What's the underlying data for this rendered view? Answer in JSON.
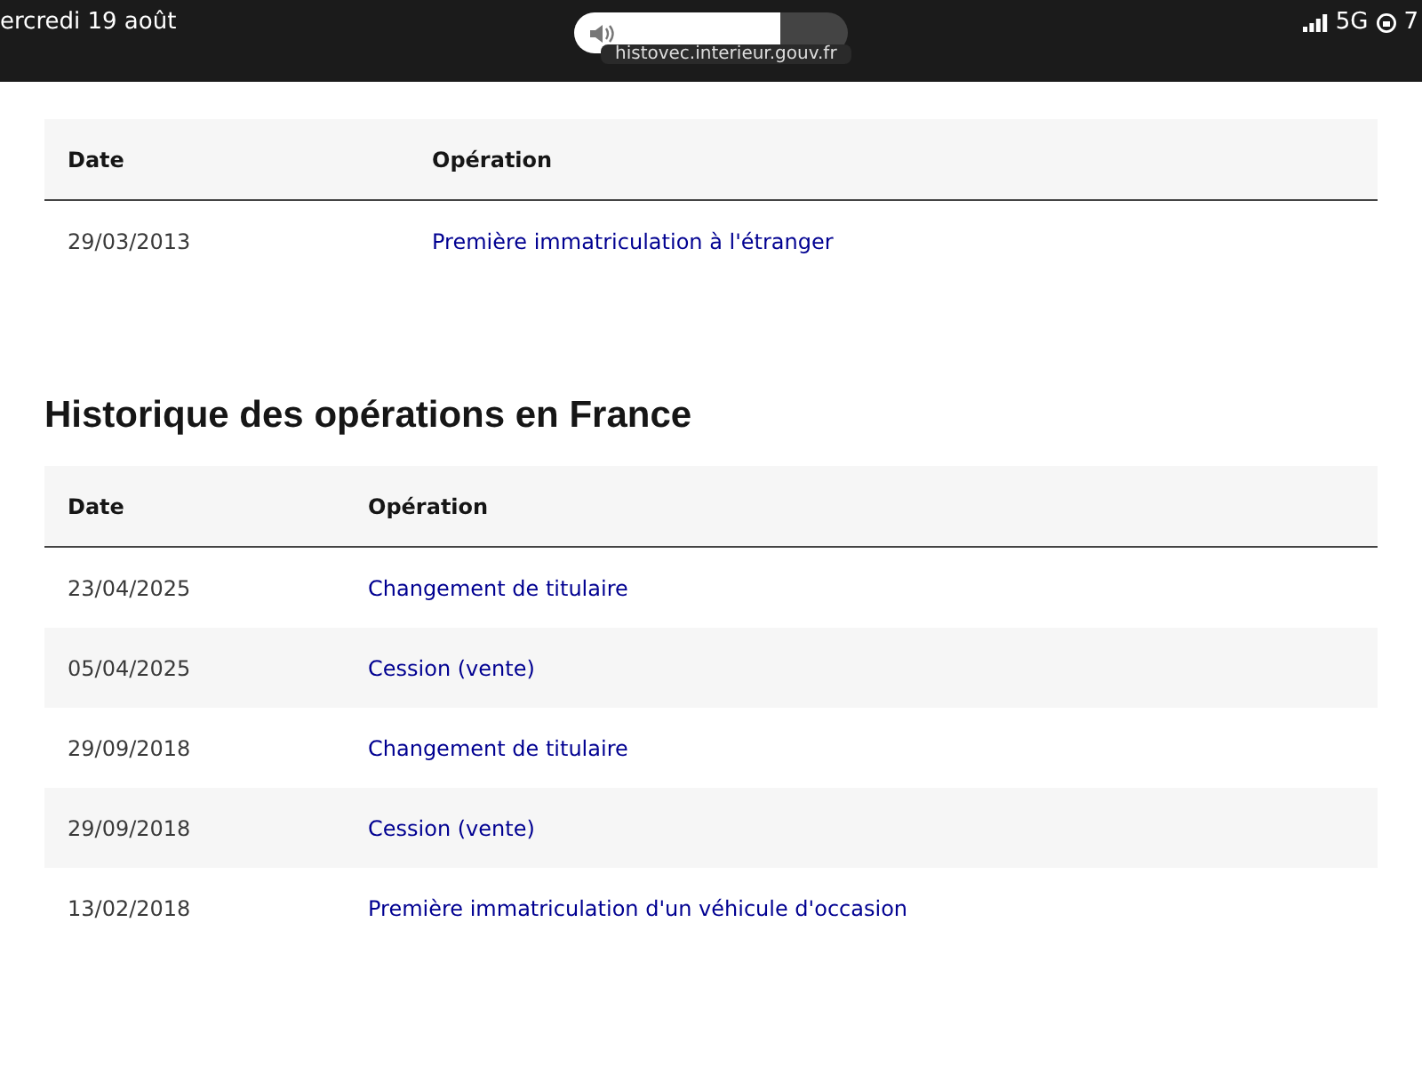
{
  "status_bar": {
    "date": "ercredi 19 août",
    "network": "5G",
    "battery": "7",
    "volume": {
      "level": 0.75
    },
    "url": "histovec.interieur.gouv.fr"
  },
  "sections": [
    {
      "columns": [
        "Date",
        "Opération"
      ],
      "rows": [
        {
          "date": "29/03/2013",
          "operation": "Première immatriculation à l'étranger"
        }
      ]
    },
    {
      "title": "Historique des opérations en France",
      "columns": [
        "Date",
        "Opération"
      ],
      "rows": [
        {
          "date": "23/04/2025",
          "operation": "Changement de titulaire"
        },
        {
          "date": "05/04/2025",
          "operation": "Cession (vente)"
        },
        {
          "date": "29/09/2018",
          "operation": "Changement de titulaire"
        },
        {
          "date": "29/09/2018",
          "operation": "Cession (vente)"
        },
        {
          "date": "13/02/2018",
          "operation": "Première immatriculation d'un véhicule d'occasion"
        }
      ]
    }
  ]
}
